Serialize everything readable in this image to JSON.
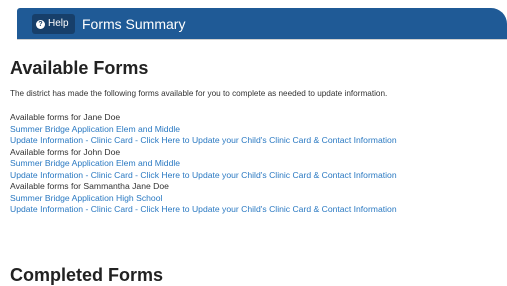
{
  "header": {
    "help_label": "Help",
    "help_icon": "question-circle-icon",
    "title": "Forms Summary",
    "bar_color": "#1f5a96"
  },
  "available": {
    "heading": "Available Forms",
    "intro": "The district has made the following forms available for you to complete as needed to update information.",
    "groups": [
      {
        "label": "Available forms for Jane Doe",
        "links": [
          "Summer Bridge Application Elem and Middle",
          "Update Information - Clinic Card - Click Here to Update your Child's Clinic Card & Contact Information"
        ]
      },
      {
        "label": "Available forms for John Doe",
        "links": [
          "Summer Bridge Application Elem and Middle",
          "Update Information - Clinic Card - Click Here to Update your Child's Clinic Card & Contact Information"
        ]
      },
      {
        "label": "Available forms for Sammantha Jane Doe",
        "links": [
          "Summer Bridge Application High School",
          "Update Information - Clinic Card - Click Here to Update your Child's Clinic Card & Contact Information"
        ]
      }
    ]
  },
  "completed": {
    "heading": "Completed Forms"
  },
  "colors": {
    "link": "#2a79c2",
    "heading": "#222222"
  }
}
